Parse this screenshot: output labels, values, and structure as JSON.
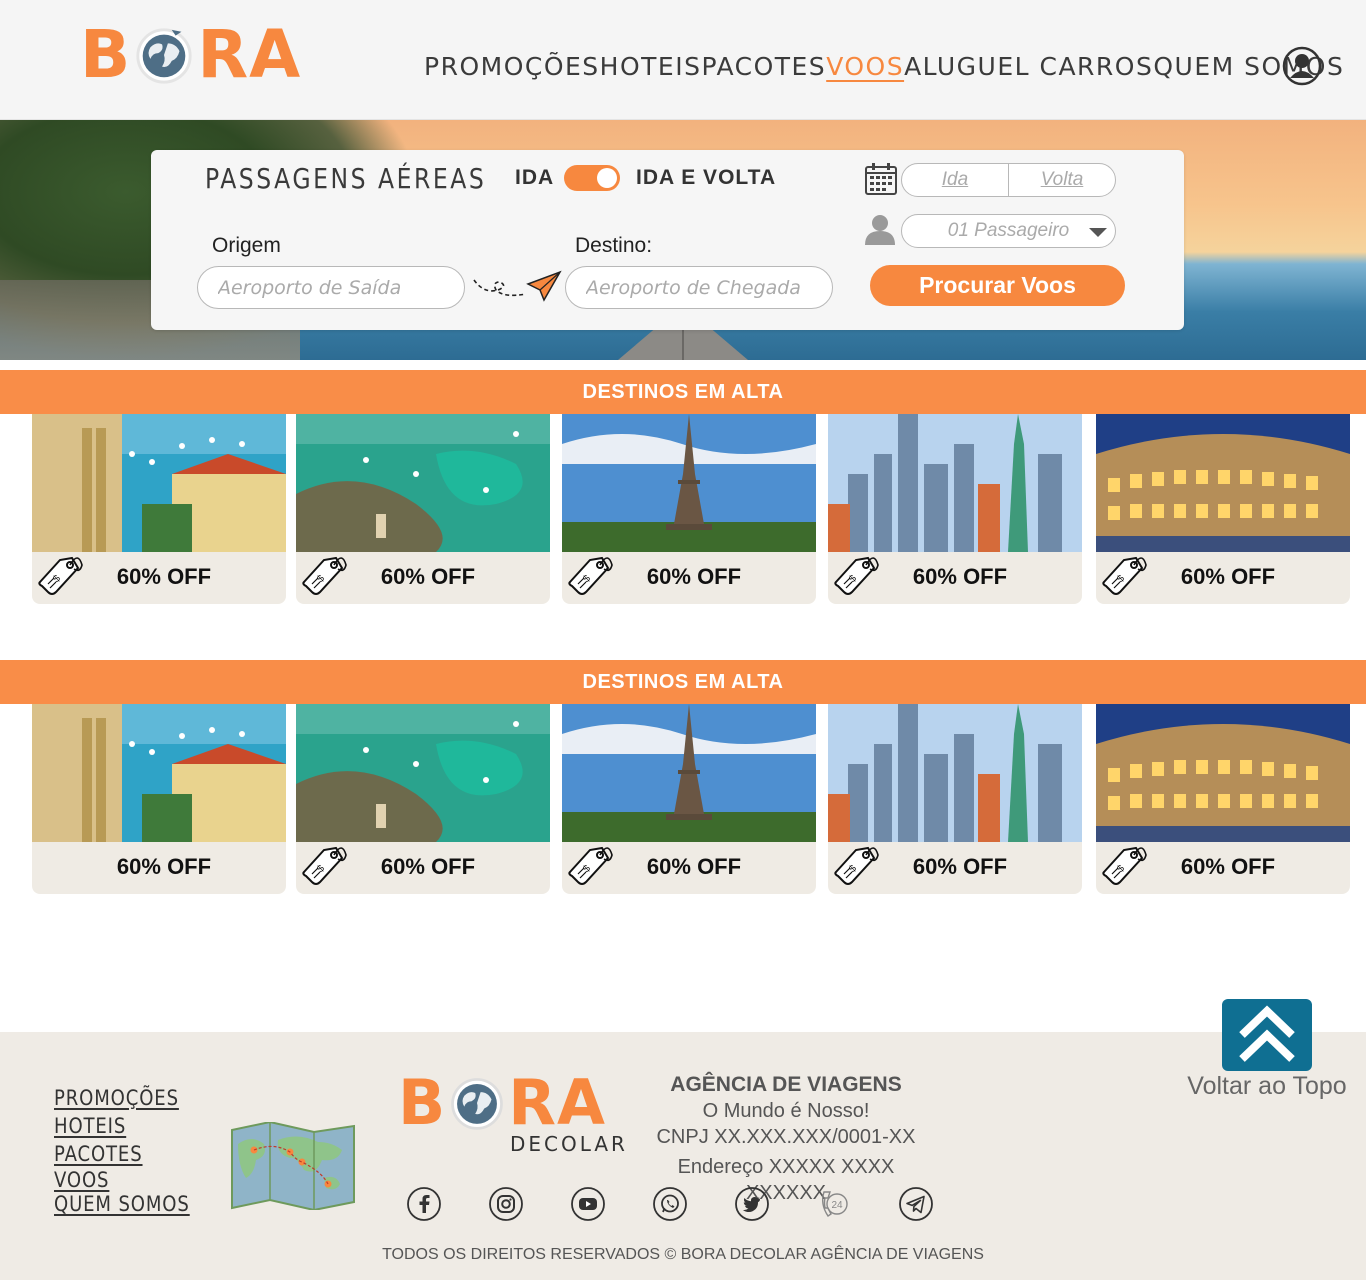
{
  "brand": {
    "letters_before": "B",
    "letters_after": "RA",
    "subtitle": "DECOLAR",
    "accent": "#f7883f",
    "dark_teal": "#0f6f92"
  },
  "nav": {
    "items": [
      "PROMOÇÕES",
      "HOTEIS",
      "PACOTES",
      "VOOS",
      "ALUGUEL CARROS",
      "QUEM SOMOS"
    ],
    "active": "VOOS",
    "user_icon": "user-circle-icon"
  },
  "search": {
    "title": "PASSAGENS AÉREAS",
    "toggle_left": "IDA",
    "toggle_right": "IDA E VOLTA",
    "origin_label": "Origem",
    "origin_placeholder": "Aeroporto de Saída",
    "destination_label": "Destino:",
    "destination_placeholder": "Aeroporto de Chegada",
    "date_ida": "Ida",
    "date_volta": "Volta",
    "passengers": "01 Passageiro",
    "button": "Procurar Voos"
  },
  "sections": [
    {
      "title": "DESTINOS EM ALTA",
      "cards": [
        {
          "destination": "salvador",
          "offer": "60% OFF"
        },
        {
          "destination": "porto-de-galinhas",
          "offer": "60% OFF"
        },
        {
          "destination": "paris",
          "offer": "60% OFF"
        },
        {
          "destination": "new-york",
          "offer": "60% OFF"
        },
        {
          "destination": "rome",
          "offer": "60% OFF"
        }
      ]
    },
    {
      "title": "DESTINOS EM ALTA",
      "cards": [
        {
          "destination": "salvador",
          "offer": "60% OFF"
        },
        {
          "destination": "porto-de-galinhas",
          "offer": "60% OFF"
        },
        {
          "destination": "paris",
          "offer": "60% OFF"
        },
        {
          "destination": "new-york",
          "offer": "60% OFF"
        },
        {
          "destination": "rome",
          "offer": "60% OFF"
        }
      ]
    }
  ],
  "footer": {
    "links": [
      "PROMOÇÕES",
      "HOTEIS",
      "PACOTES",
      "VOOS",
      "QUEM SOMOS"
    ],
    "agency_title": "AGÊNCIA DE VIAGENS",
    "tagline": "O Mundo é Nosso!",
    "cnpj": "CNPJ XX.XXX.XXX/0001-XX",
    "address": "Endereço XXXXX XXXX XXXXXX",
    "socials": [
      "facebook-icon",
      "instagram-icon",
      "youtube-icon",
      "whatsapp-icon",
      "twitter-icon",
      "phone-24h-icon",
      "telegram-icon"
    ],
    "copyright": "TODOS OS DIREITOS RESERVADOS © BORA DECOLAR AGÊNCIA DE VIAGENS",
    "back_to_top": "Voltar ao Topo"
  }
}
